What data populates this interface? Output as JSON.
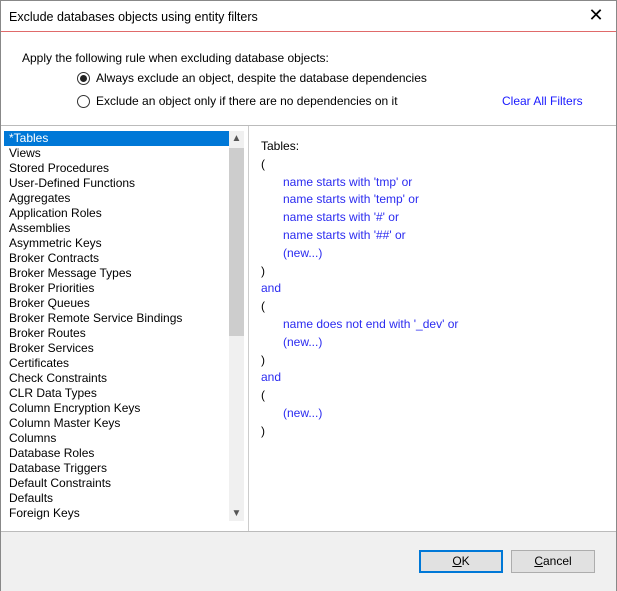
{
  "dialog": {
    "title": "Exclude databases objects using entity filters",
    "close_icon": "close-icon"
  },
  "rule": {
    "label": "Apply the following rule when excluding database objects:",
    "options": [
      {
        "label": "Always exclude an object, despite the database dependencies",
        "selected": true
      },
      {
        "label": "Exclude an object only if there are no dependencies on it",
        "selected": false
      }
    ]
  },
  "clear_all": "Clear All Filters",
  "object_types": [
    "*Tables",
    "Views",
    "Stored Procedures",
    "User-Defined Functions",
    "Aggregates",
    "Application Roles",
    "Assemblies",
    "Asymmetric Keys",
    "Broker Contracts",
    "Broker Message Types",
    "Broker Priorities",
    "Broker Queues",
    "Broker Remote Service Bindings",
    "Broker Routes",
    "Broker Services",
    "Certificates",
    "Check Constraints",
    "CLR Data Types",
    "Column Encryption Keys",
    "Column Master Keys",
    "Columns",
    "Database Roles",
    "Database Triggers",
    "Default Constraints",
    "Defaults",
    "Foreign Keys"
  ],
  "selected_index": 0,
  "filter": {
    "heading": "Tables:",
    "lines": [
      {
        "text": "(",
        "kind": "paren"
      },
      {
        "text": "name starts with 'tmp' or",
        "kind": "cond"
      },
      {
        "text": "name starts with 'temp' or",
        "kind": "cond"
      },
      {
        "text": "name starts with '#' or",
        "kind": "cond"
      },
      {
        "text": "name starts with '##' or",
        "kind": "cond"
      },
      {
        "text": "(new...)",
        "kind": "cond"
      },
      {
        "text": ")",
        "kind": "paren"
      },
      {
        "text": "and",
        "kind": "op"
      },
      {
        "text": "(",
        "kind": "paren"
      },
      {
        "text": "name does not end with '_dev' or",
        "kind": "cond"
      },
      {
        "text": "(new...)",
        "kind": "cond"
      },
      {
        "text": ")",
        "kind": "paren"
      },
      {
        "text": "and",
        "kind": "op"
      },
      {
        "text": "(",
        "kind": "paren"
      },
      {
        "text": "(new...)",
        "kind": "cond"
      },
      {
        "text": ")",
        "kind": "paren"
      }
    ]
  },
  "buttons": {
    "ok": "OK",
    "cancel": "Cancel"
  }
}
